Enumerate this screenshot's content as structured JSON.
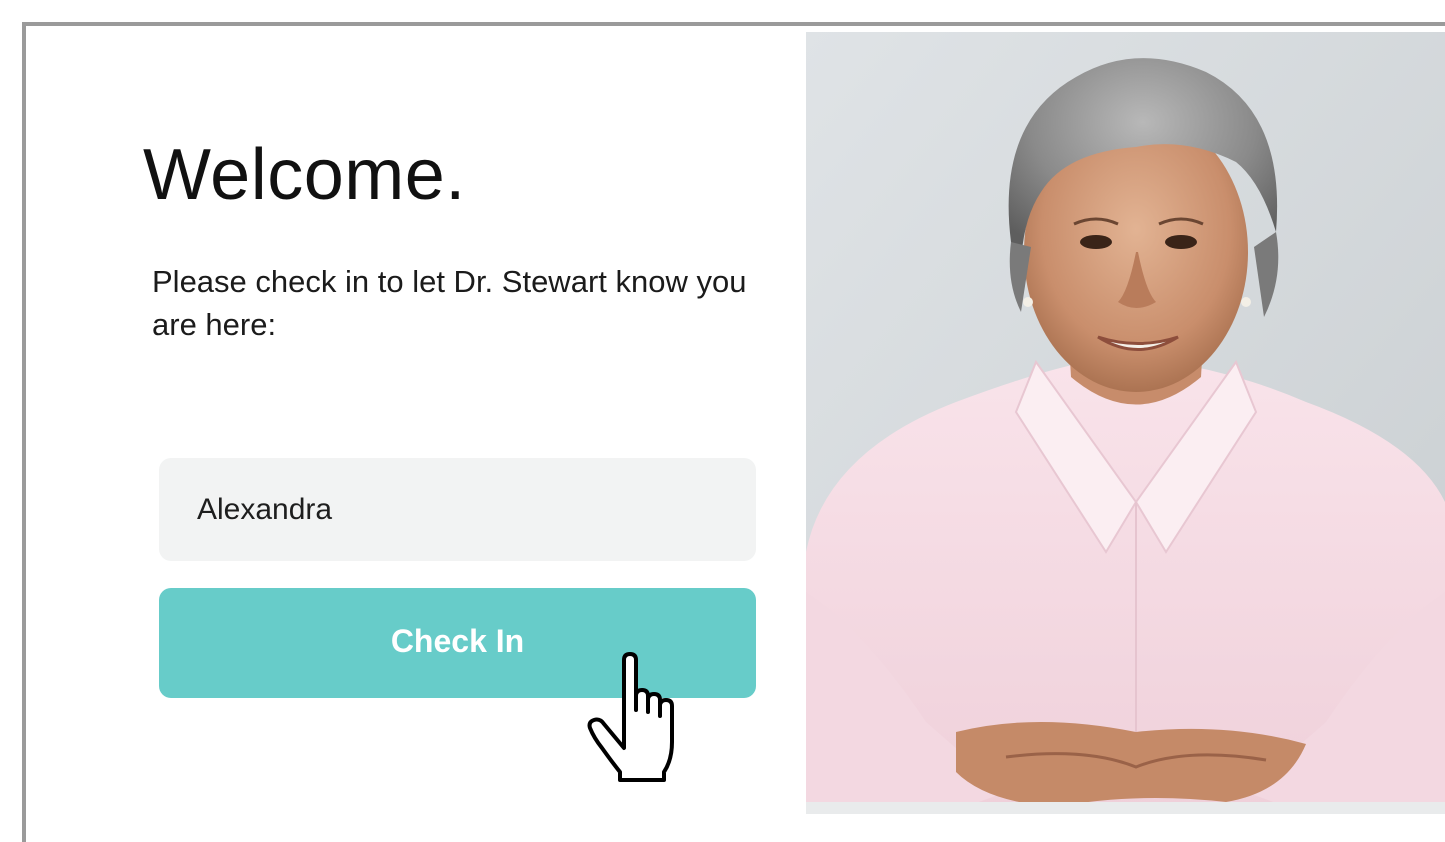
{
  "welcome": {
    "title": "Welcome.",
    "message": "Please check in to let Dr. Stewart know you are here:"
  },
  "form": {
    "name_value": "Alexandra",
    "checkin_label": "Check In"
  },
  "colors": {
    "accent": "#67ccc9",
    "input_bg": "#f2f3f3",
    "frame_border": "#9a9a9a"
  },
  "icons": {
    "cursor": "hand-pointer-icon"
  }
}
